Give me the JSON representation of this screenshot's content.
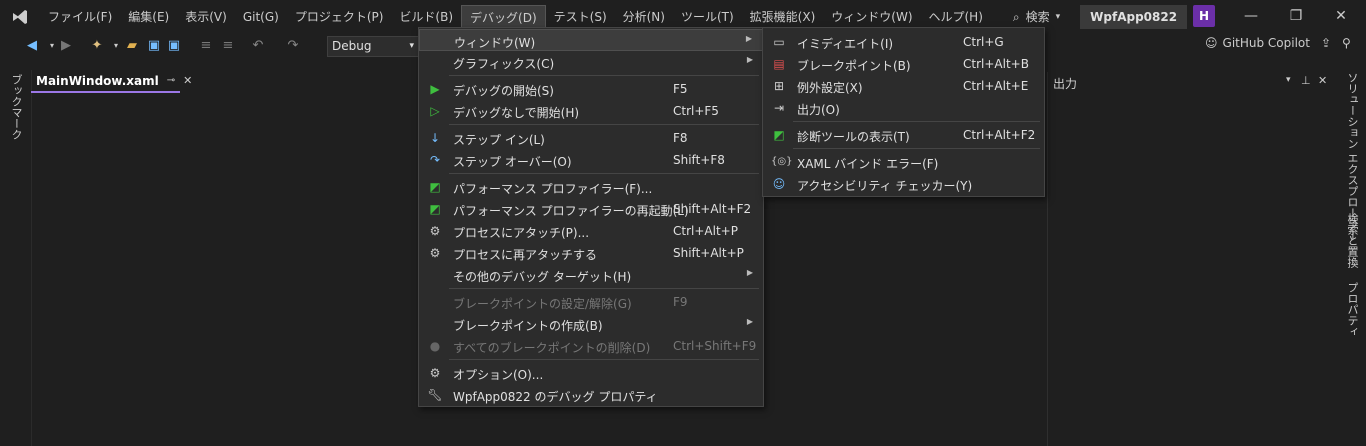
{
  "menubar": {
    "items": [
      "ファイル(F)",
      "編集(E)",
      "表示(V)",
      "Git(G)",
      "プロジェクト(P)",
      "ビルド(B)",
      "デバッグ(D)",
      "テスト(S)",
      "分析(N)",
      "ツール(T)",
      "拡張機能(X)",
      "ウィンドウ(W)",
      "ヘルプ(H)"
    ],
    "search_label": "検索",
    "project_name": "WpfApp0822",
    "profile_initial": "H"
  },
  "toolbar": {
    "config_value": "Debug",
    "copilot_label": "GitHub Copilot"
  },
  "left_rail": {
    "bookmark_label": "ブックマーク"
  },
  "editor": {
    "tab_label": "MainWindow.xaml"
  },
  "output_panel": {
    "title": "出力"
  },
  "right_rail": {
    "items": [
      "ソリューション エクスプローラー",
      "検索と置換",
      "プロパティ"
    ]
  },
  "debug_menu": {
    "items": [
      {
        "label": "ウィンドウ(W)",
        "shortcut": "",
        "submenu": true
      },
      {
        "label": "グラフィックス(C)",
        "shortcut": "",
        "submenu": true
      },
      {
        "label": "デバッグの開始(S)",
        "shortcut": "F5"
      },
      {
        "label": "デバッグなしで開始(H)",
        "shortcut": "Ctrl+F5"
      },
      {
        "label": "ステップ イン(L)",
        "shortcut": "F8"
      },
      {
        "label": "ステップ オーバー(O)",
        "shortcut": "Shift+F8"
      },
      {
        "label": "パフォーマンス プロファイラー(F)...",
        "shortcut": ""
      },
      {
        "label": "パフォーマンス プロファイラーの再起動(L)",
        "shortcut": "Shift+Alt+F2"
      },
      {
        "label": "プロセスにアタッチ(P)...",
        "shortcut": "Ctrl+Alt+P"
      },
      {
        "label": "プロセスに再アタッチする",
        "shortcut": "Shift+Alt+P"
      },
      {
        "label": "その他のデバッグ ターゲット(H)",
        "shortcut": "",
        "submenu": true
      },
      {
        "label": "ブレークポイントの設定/解除(G)",
        "shortcut": "F9",
        "disabled": true
      },
      {
        "label": "ブレークポイントの作成(B)",
        "shortcut": "",
        "submenu": true
      },
      {
        "label": "すべてのブレークポイントの削除(D)",
        "shortcut": "Ctrl+Shift+F9",
        "disabled": true
      },
      {
        "label": "オプション(O)...",
        "shortcut": ""
      },
      {
        "label": "WpfApp0822 のデバッグ プロパティ",
        "shortcut": ""
      }
    ]
  },
  "window_submenu": {
    "items": [
      {
        "label": "イミディエイト(I)",
        "shortcut": "Ctrl+G"
      },
      {
        "label": "ブレークポイント(B)",
        "shortcut": "Ctrl+Alt+B"
      },
      {
        "label": "例外設定(X)",
        "shortcut": "Ctrl+Alt+E"
      },
      {
        "label": "出力(O)",
        "shortcut": ""
      },
      {
        "label": "診断ツールの表示(T)",
        "shortcut": "Ctrl+Alt+F2"
      },
      {
        "label": "XAML バインド エラー(F)",
        "shortcut": ""
      },
      {
        "label": "アクセシビリティ チェッカー(Y)",
        "shortcut": ""
      }
    ]
  },
  "colors": {
    "accent": "#9b77e6",
    "play_green": "#3fbf3f",
    "profile_purple": "#6b2fa8",
    "icon_blue": "#75beff"
  }
}
